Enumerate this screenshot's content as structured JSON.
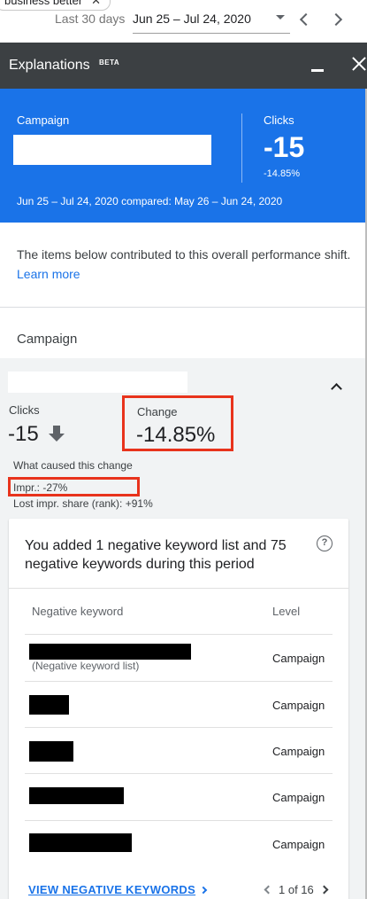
{
  "top_bar": {
    "chip_label": "business better",
    "range_label": "Last 30 days",
    "date_range": "Jun 25 – Jul 24, 2020"
  },
  "panel": {
    "title": "Explanations",
    "beta": "BETA"
  },
  "summary": {
    "campaign_label": "Campaign",
    "clicks_label": "Clicks",
    "clicks_value": "-15",
    "clicks_pct": "-14.85%",
    "comparison": "Jun 25 – Jul 24, 2020 compared: May 26 – Jun 24, 2020",
    "bg_color": "#1a73e8"
  },
  "intro": {
    "text": "The items below contributed to this overall performance shift.",
    "link": "Learn more"
  },
  "campaign_section": {
    "heading": "Campaign",
    "clicks_label": "Clicks",
    "clicks_value": "-15",
    "change_label": "Change",
    "change_value": "-14.85%",
    "caused_label": "What caused this change",
    "impr": "Impr.: -27%",
    "lost_share": "Lost impr. share (rank): +91%"
  },
  "card": {
    "title": "You added 1 negative keyword list and 75 negative keywords during this period",
    "columns": [
      "Negative keyword",
      "Level"
    ],
    "rows": [
      {
        "sub": "(Negative keyword list)",
        "level": "Campaign"
      },
      {
        "sub": "",
        "level": "Campaign"
      },
      {
        "sub": "",
        "level": "Campaign"
      },
      {
        "sub": "",
        "level": "Campaign"
      },
      {
        "sub": "",
        "level": "Campaign"
      }
    ],
    "view_link": "VIEW NEGATIVE KEYWORDS",
    "pager": "1 of 16"
  },
  "colors": {
    "accent": "#1a73e8",
    "highlight_border": "#e8331c",
    "header_bg": "#3c4043"
  }
}
